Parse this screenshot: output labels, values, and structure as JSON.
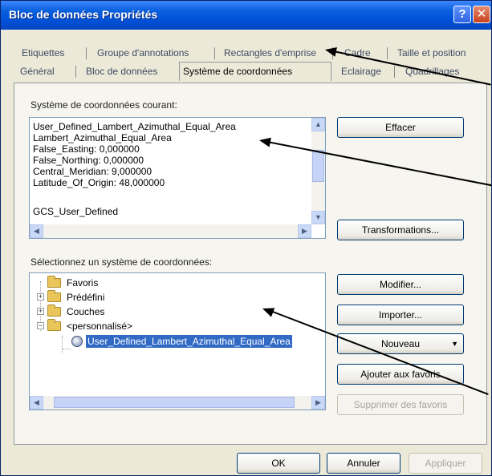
{
  "window": {
    "title": "Bloc de données Propriétés"
  },
  "tabs_row1": [
    "Etiquettes",
    "Groupe d'annotations",
    "Rectangles d'emprise",
    "Cadre",
    "Taille et position"
  ],
  "tabs_row2": [
    "Général",
    "Bloc de données",
    "Système de coordonnées",
    "Eclairage",
    "Quadrillages"
  ],
  "active_tab": "Système de coordonnées",
  "current_cs": {
    "label": "Système de coordonnées courant:",
    "lines": [
      "User_Defined_Lambert_Azimuthal_Equal_Area",
      "Lambert_Azimuthal_Equal_Area",
      "False_Easting: 0,000000",
      "False_Northing: 0,000000",
      "Central_Meridian: 9,000000",
      "Latitude_Of_Origin: 48,000000",
      "",
      "GCS_User_Defined"
    ]
  },
  "buttons": {
    "effacer": "Effacer",
    "transformations": "Transformations...",
    "modifier": "Modifier...",
    "importer": "Importer...",
    "nouveau": "Nouveau",
    "ajouter": "Ajouter aux favoris",
    "supprimer": "Supprimer des favoris",
    "ok": "OK",
    "annuler": "Annuler",
    "appliquer": "Appliquer"
  },
  "select_cs": {
    "label": "Sélectionnez un système de coordonnées:",
    "tree": {
      "favoris": "Favoris",
      "predefini": "Prédéfini",
      "couches": "Couches",
      "personnalise": "<personnalisé>",
      "selected_item": "User_Defined_Lambert_Azimuthal_Equal_Area"
    }
  },
  "icons": {
    "help": "help-icon",
    "close": "close-icon",
    "folder": "folder-icon",
    "globe": "globe-icon",
    "scroll_up": "scroll-up-icon",
    "scroll_down": "scroll-down-icon",
    "scroll_left": "scroll-left-icon",
    "scroll_right": "scroll-right-icon",
    "dropdown": "chevron-down-icon"
  },
  "colors": {
    "titlebar": "#0a5fdc",
    "selection": "#316ac5",
    "dialog_bg": "#ece9d8"
  }
}
